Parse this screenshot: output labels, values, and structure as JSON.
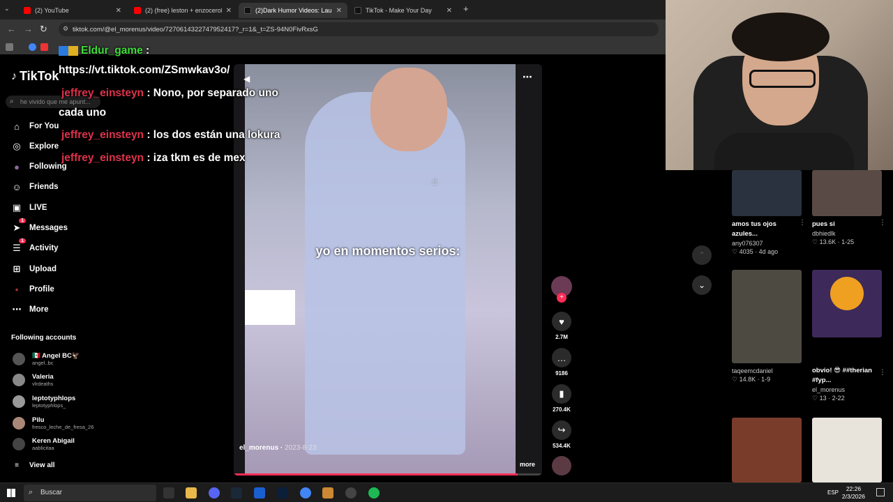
{
  "browser": {
    "tabs": [
      {
        "title": "(2) YouTube",
        "color": "#ff0000"
      },
      {
        "title": "(2) (free) leston + enzocerobuli",
        "color": "#ff0000"
      },
      {
        "title": "(2)Dark Humor Videos: Lau",
        "color": "#ffffff",
        "active": true
      },
      {
        "title": "TikTok - Make Your Day",
        "color": "#ffffff"
      }
    ],
    "url": "tiktok.com/@el_morenus/video/7270614322747952417?_r=1&_t=ZS-94N0FivRxsG"
  },
  "tiktok": {
    "logo": "TikTok",
    "search_placeholder": "he vivido que me apunt...",
    "nav": [
      {
        "label": "For You",
        "icon": "home-icon",
        "glyph": "⌂"
      },
      {
        "label": "Explore",
        "icon": "compass-icon",
        "glyph": "◎"
      },
      {
        "label": "Following",
        "icon": "avatar-icon",
        "glyph": "●"
      },
      {
        "label": "Friends",
        "icon": "friends-icon",
        "glyph": "☺"
      },
      {
        "label": "LIVE",
        "icon": "live-icon",
        "glyph": "▣"
      },
      {
        "label": "Messages",
        "icon": "messages-icon",
        "glyph": "➤",
        "badge": "1"
      },
      {
        "label": "Activity",
        "icon": "activity-icon",
        "glyph": "☰",
        "badge": "1"
      },
      {
        "label": "Upload",
        "icon": "upload-icon",
        "glyph": "⊞"
      },
      {
        "label": "Profile",
        "icon": "profile-icon",
        "glyph": "•"
      },
      {
        "label": "More",
        "icon": "more-icon",
        "glyph": "⋯"
      }
    ],
    "following_header": "Following accounts",
    "accounts": [
      {
        "name": "🇲🇽 Angel BC🦅",
        "handle": "angel..bc"
      },
      {
        "name": "Valeria",
        "handle": "vlrdeaths"
      },
      {
        "name": "leptotyphlops",
        "handle": "leptotyphlops_"
      },
      {
        "name": "Pilu",
        "handle": "fresco_leche_de_fresa_26"
      },
      {
        "name": "Keren Abigail",
        "handle": "aablicitaa"
      }
    ],
    "view_all": "View all",
    "video": {
      "caption": "yo en momentos serios:",
      "emoji": "😂",
      "author": "el_morenus",
      "date": "2023-8-23",
      "more": "more",
      "progress": 0.92
    },
    "actions": [
      {
        "icon": "heart-icon",
        "glyph": "♥",
        "count": "2.7M"
      },
      {
        "icon": "comment-icon",
        "glyph": "…",
        "count": "9186"
      },
      {
        "icon": "bookmark-icon",
        "glyph": "▮",
        "count": "270.4K"
      },
      {
        "icon": "share-icon",
        "glyph": "↪",
        "count": "534.4K"
      }
    ],
    "related": [
      {
        "title": "amos tus ojos azules...",
        "user": "any076307",
        "meta": "♡ 4035 · 4d ago",
        "thumb": "#2a3240"
      },
      {
        "title": "pues si",
        "user": "dbhiedlk",
        "meta": "♡ 13.6K · 1-25",
        "thumb": "#5a4a45"
      },
      {
        "title": "",
        "user": "taqeemcdaniel",
        "meta": "♡ 14.8K · 1-9",
        "thumb": "#4d4a42"
      },
      {
        "title": "obvio! 😎 ##therian #fyp...",
        "user": "el_morenus",
        "meta": "♡ 13 · 2-22",
        "thumb": "#3d2a5a"
      },
      {
        "title": "",
        "user": "",
        "meta": "",
        "thumb": "#7a3c2a"
      },
      {
        "title": "",
        "user": "",
        "meta": "",
        "thumb": "#e8e4dc"
      }
    ]
  },
  "chat": [
    {
      "user": "Eldur_game",
      "text": ":",
      "user_color": "green"
    },
    {
      "user": "",
      "text": "https://vt.tiktok.com/ZSmwkav3o/"
    },
    {
      "user": "jeffrey_einsteyn",
      "text": ": Nono, por separado uno"
    },
    {
      "user": "",
      "text": "cada uno"
    },
    {
      "user": "jeffrey_einsteyn",
      "text": ": los dos están una lokura"
    },
    {
      "user": "jeffrey_einsteyn",
      "text": ": iza tkm es de mex"
    }
  ],
  "taskbar": {
    "search": "Buscar",
    "lang": "ESP",
    "time": "22:26",
    "date": "2/3/2026"
  }
}
